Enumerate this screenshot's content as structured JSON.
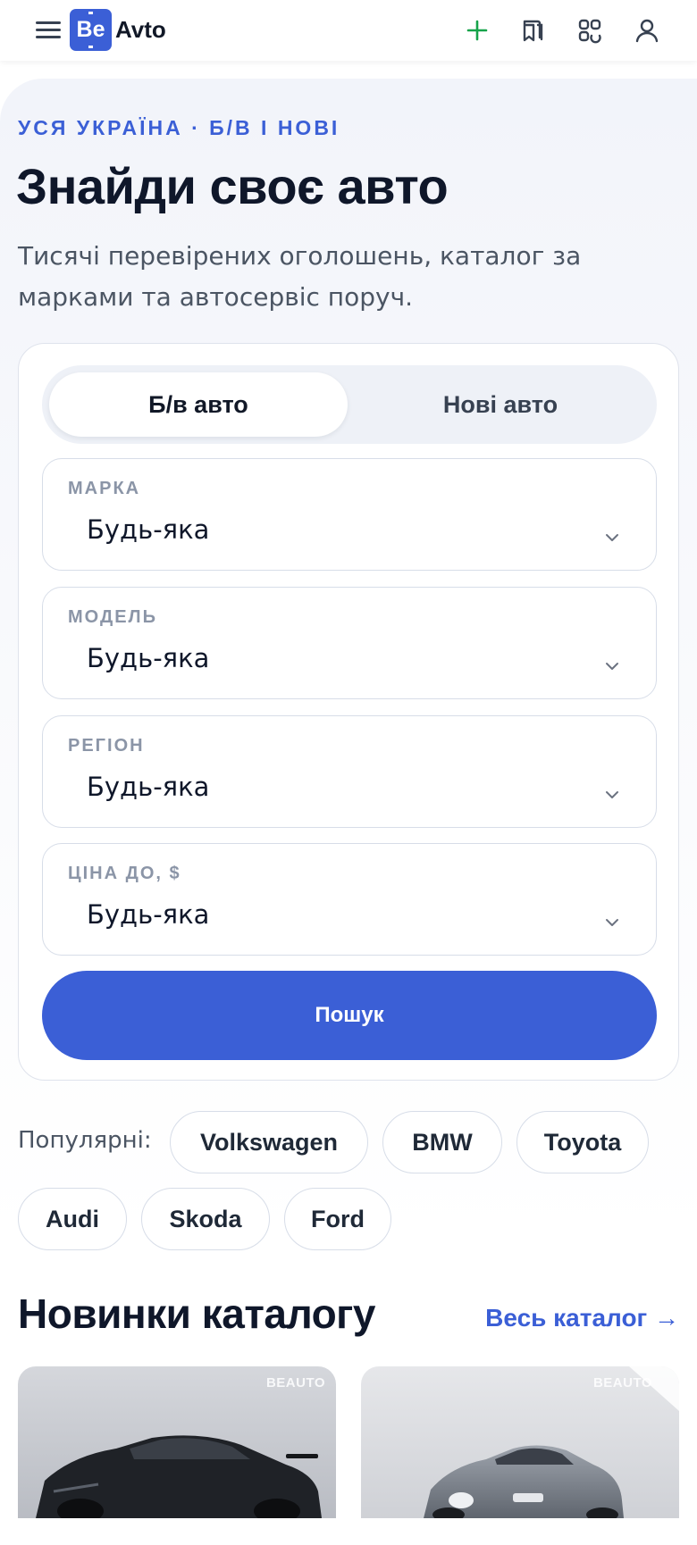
{
  "header": {
    "logo_badge": "Be",
    "logo_text": "Avto",
    "icons": [
      "menu-icon",
      "plus-icon",
      "book-icon",
      "scan-icon",
      "user-icon"
    ],
    "accent_plus": "#16a34a"
  },
  "hero": {
    "eyebrow": "УСЯ УКРАЇНА · Б/В І НОВІ",
    "title": "Знайди своє авто",
    "subtitle": "Тисячі перевірених оголошень, каталог за марками та автосервіс поруч."
  },
  "search": {
    "tabs": [
      {
        "label": "Б/в авто",
        "active": true
      },
      {
        "label": "Нові авто",
        "active": false
      }
    ],
    "fields": [
      {
        "label": "МАРКА",
        "value": "Будь-яка"
      },
      {
        "label": "МОДЕЛЬ",
        "value": "Будь-яка"
      },
      {
        "label": "РЕГІОН",
        "value": "Будь-яка"
      },
      {
        "label": "ЦІНА ДО, $",
        "value": "Будь-яка"
      }
    ],
    "button_label": "Пошук"
  },
  "popular": {
    "label": "Популярні:",
    "chips": [
      "Volkswagen",
      "BMW",
      "Toyota",
      "Audi",
      "Skoda",
      "Ford"
    ]
  },
  "catalog": {
    "title": "Новинки каталогу",
    "link": "Весь каталог →",
    "watermark": "BEAUTO",
    "cards": [
      {
        "image": "black-sports-sedan"
      },
      {
        "image": "silver-electric-coupe"
      }
    ]
  },
  "colors": {
    "brand": "#3b5fd6",
    "text": "#0f172a",
    "muted": "#8b95a7",
    "border": "#d7dde8"
  }
}
